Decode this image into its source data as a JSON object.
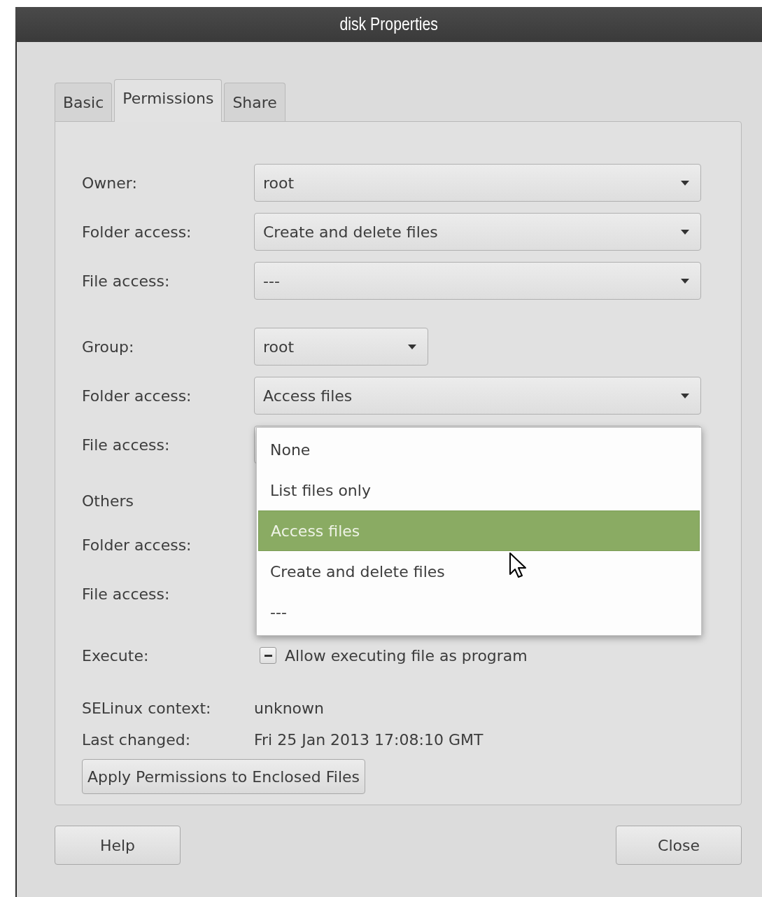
{
  "window": {
    "title": "disk Properties"
  },
  "tabs": [
    {
      "label": "Basic",
      "selected": false
    },
    {
      "label": "Permissions",
      "selected": true
    },
    {
      "label": "Share",
      "selected": false
    }
  ],
  "permissions": {
    "sections": [
      {
        "rows": [
          {
            "kind": "combo",
            "label": "Owner:",
            "value": "root"
          },
          {
            "kind": "combo",
            "label": "Folder access:",
            "value": "Create and delete files"
          },
          {
            "kind": "combo",
            "label": "File access:",
            "value": "---"
          }
        ]
      },
      {
        "rows": [
          {
            "kind": "combo-short",
            "label": "Group:",
            "value": "root"
          },
          {
            "kind": "combo",
            "label": "Folder access:",
            "value": "Access files"
          },
          {
            "kind": "combo-covered",
            "label": "File access:"
          }
        ]
      },
      {
        "rows": [
          {
            "kind": "heading",
            "label": "Others"
          },
          {
            "kind": "label",
            "label": "Folder access:"
          },
          {
            "kind": "label",
            "label": "File access:"
          }
        ]
      },
      {
        "rows": [
          {
            "kind": "checkbox",
            "label": "Execute:",
            "text": "Allow executing file as program",
            "mixed": true
          }
        ]
      },
      {
        "rows": [
          {
            "kind": "info",
            "label": "SELinux context:",
            "value": "unknown"
          },
          {
            "kind": "info",
            "label": "Last changed:",
            "value": "Fri 25 Jan 2013 17:08:10 GMT"
          }
        ]
      }
    ],
    "apply_button": "Apply Permissions to Enclosed Files"
  },
  "dropdown_menu": {
    "items": [
      {
        "label": "None",
        "selected": false
      },
      {
        "label": "List files only",
        "selected": false
      },
      {
        "label": "Access files",
        "selected": true
      },
      {
        "label": "Create and delete files",
        "selected": false
      },
      {
        "label": "---",
        "selected": false
      }
    ]
  },
  "buttons": {
    "help": "Help",
    "close": "Close"
  }
}
